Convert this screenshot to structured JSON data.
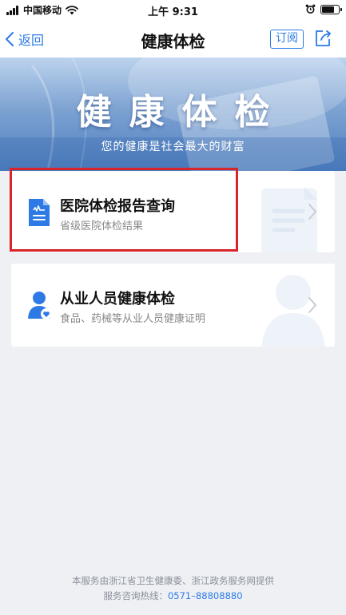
{
  "status_bar": {
    "carrier": "中国移动",
    "time": "上午 9:31",
    "battery_level": 0.8
  },
  "nav": {
    "back_label": "返回",
    "title": "健康体检",
    "subscribe_label": "订阅",
    "share_icon": "share-icon"
  },
  "banner": {
    "title": "健康体检",
    "subtitle": "您的健康是社会最大的财富"
  },
  "cards": [
    {
      "title": "医院体检报告查询",
      "subtitle": "省级医院体检结果",
      "icon": "report-document-icon",
      "highlighted": true
    },
    {
      "title": "从业人员健康体检",
      "subtitle": "食品、药械等从业人员健康证明",
      "icon": "person-heart-icon",
      "highlighted": false
    }
  ],
  "footer": {
    "provider": "本服务由浙江省卫生健康委、浙江政务服务网提供",
    "hotline_label": "服务咨询热线：",
    "hotline_number": "0571–88808880"
  },
  "colors": {
    "accent": "#2d7ae6",
    "highlight": "#d8252b",
    "background": "#eef0f4"
  }
}
